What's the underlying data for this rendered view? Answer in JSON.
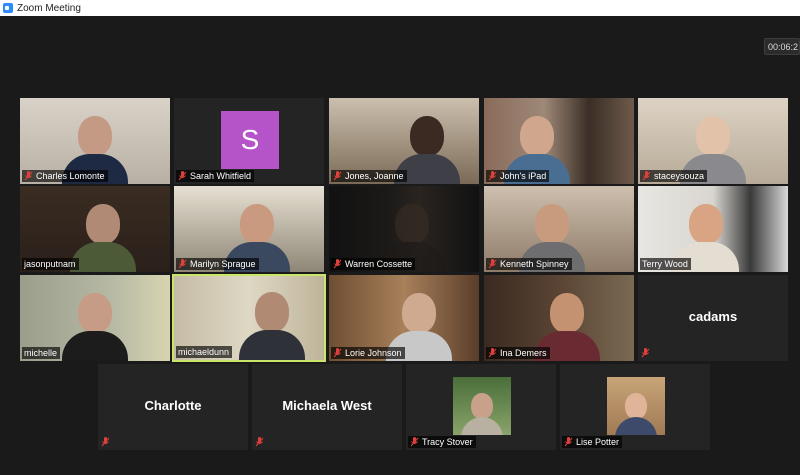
{
  "window": {
    "title": "Zoom Meeting"
  },
  "meeting": {
    "timer": "00:06:2"
  },
  "participants": [
    {
      "name": "Charles Lomonte",
      "muted": true
    },
    {
      "name": "Sarah Whitfield",
      "muted": true,
      "avatar_letter": "S",
      "avatar_color": "#b554c9"
    },
    {
      "name": "Jones, Joanne",
      "muted": true
    },
    {
      "name": "John's iPad",
      "muted": true
    },
    {
      "name": "staceysouza",
      "muted": true
    },
    {
      "name": "jasonputnam",
      "muted": false
    },
    {
      "name": "Marilyn Sprague",
      "muted": true
    },
    {
      "name": "Warren Cossette",
      "muted": true
    },
    {
      "name": "Kenneth Spinney",
      "muted": true
    },
    {
      "name": "Terry Wood",
      "muted": false
    },
    {
      "name": "michelle",
      "muted": false
    },
    {
      "name": "michaeldunn",
      "muted": false,
      "active_speaker": true
    },
    {
      "name": "Lorie Johnson",
      "muted": true
    },
    {
      "name": "Ina Demers",
      "muted": true
    },
    {
      "name": "cadams",
      "muted": true,
      "video_off": true
    },
    {
      "name": "Charlotte",
      "muted": true,
      "video_off": true
    },
    {
      "name": "Michaela West",
      "muted": true,
      "video_off": true
    },
    {
      "name": "Tracy Stover",
      "muted": true
    },
    {
      "name": "Lise Potter",
      "muted": true
    }
  ],
  "colors": {
    "active_border": "#c9e66a",
    "mute_red": "#e0403a",
    "zoom_blue": "#2d8cff"
  }
}
